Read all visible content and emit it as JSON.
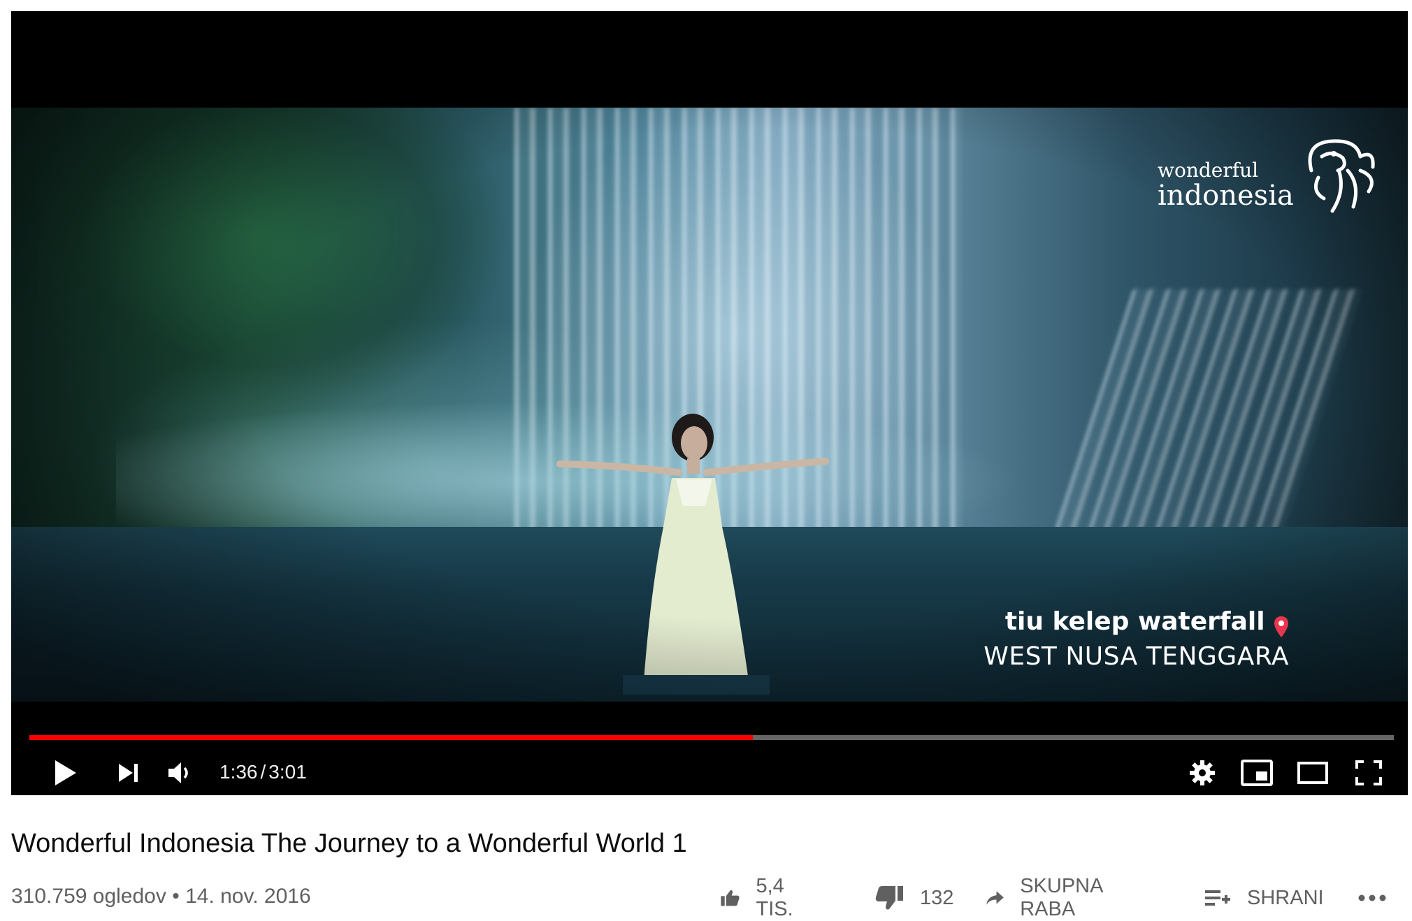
{
  "video": {
    "logo_line1": "wonderful",
    "logo_line2": "indonesia",
    "location_name": "tiu kelep waterfall",
    "location_region": "WEST NUSA TENGGARA"
  },
  "player": {
    "current_time": "1:36",
    "separator": "/",
    "duration": "3:01",
    "progress_fraction": 0.53,
    "accent_color": "#ff0000",
    "icons": [
      "play-icon",
      "next-icon",
      "volume-icon",
      "settings-icon",
      "miniplayer-icon",
      "theater-mode-icon",
      "fullscreen-icon"
    ]
  },
  "title": "Wonderful Indonesia The Journey to a Wonderful World 1",
  "meta": {
    "views": "310.759 ogledov",
    "dot": "•",
    "date": "14. nov. 2016"
  },
  "actions": {
    "like_count": "5,4 TIS.",
    "dislike_count": "132",
    "share_label": "SKUPNA RABA",
    "save_label": "SHRANI"
  }
}
